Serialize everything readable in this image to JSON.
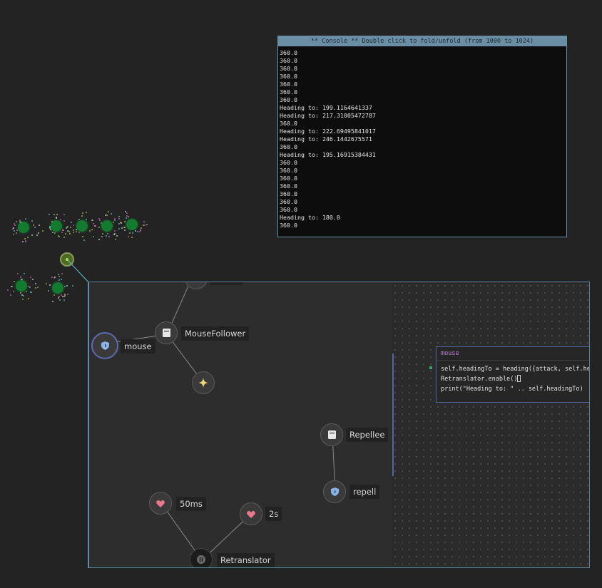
{
  "console": {
    "title": "** Console ** Double click to fold/unfold (from 1000 to 1024)",
    "lines": [
      "360.0",
      "360.0",
      "360.0",
      "360.0",
      "360.0",
      "360.0",
      "360.0",
      "Heading to: 199.1164641337",
      "Heading to: 217.31005472787",
      "360.0",
      "Heading to: 222.69495841017",
      "Heading to: 246.1442675571",
      "360.0",
      "Heading to: 195.16915384431",
      "360.0",
      "360.0",
      "360.0",
      "360.0",
      "360.0",
      "360.0",
      "360.0",
      "Heading to: 180.0",
      "360.0"
    ]
  },
  "graph": {
    "nodes": {
      "mouse": {
        "label": "mouse",
        "icon": "shield-icon"
      },
      "mouse_follower": {
        "label": "MouseFollower",
        "icon": "document-icon"
      },
      "sparkle": {
        "label": "",
        "icon": "sparkle-icon"
      },
      "repellee": {
        "label": "Repellee",
        "icon": "document-icon"
      },
      "repell": {
        "label": "repell",
        "icon": "shield-icon"
      },
      "timer_50ms": {
        "label": "50ms",
        "icon": "heart-icon"
      },
      "timer_2s": {
        "label": "2s",
        "icon": "heart-icon"
      },
      "retranslator": {
        "label": "Retranslator",
        "icon": "pause-icon"
      }
    },
    "code_editor": {
      "title": "mouse",
      "lines": [
        "self.headingTo = heading({attack, self.hea",
        "Retranslator.enable()",
        "print(\"Heading to: \" .. self.headingTo)"
      ]
    }
  },
  "colors": {
    "background": "#232323",
    "console_header": "#6a8ea3",
    "bot_green": "#137a2f",
    "selected_ring": "#5a6bb0",
    "heart": "#e8788a",
    "sparkle": "#f2d47a",
    "shield": "#8ab4e8",
    "code_title": "#c77ddb"
  }
}
